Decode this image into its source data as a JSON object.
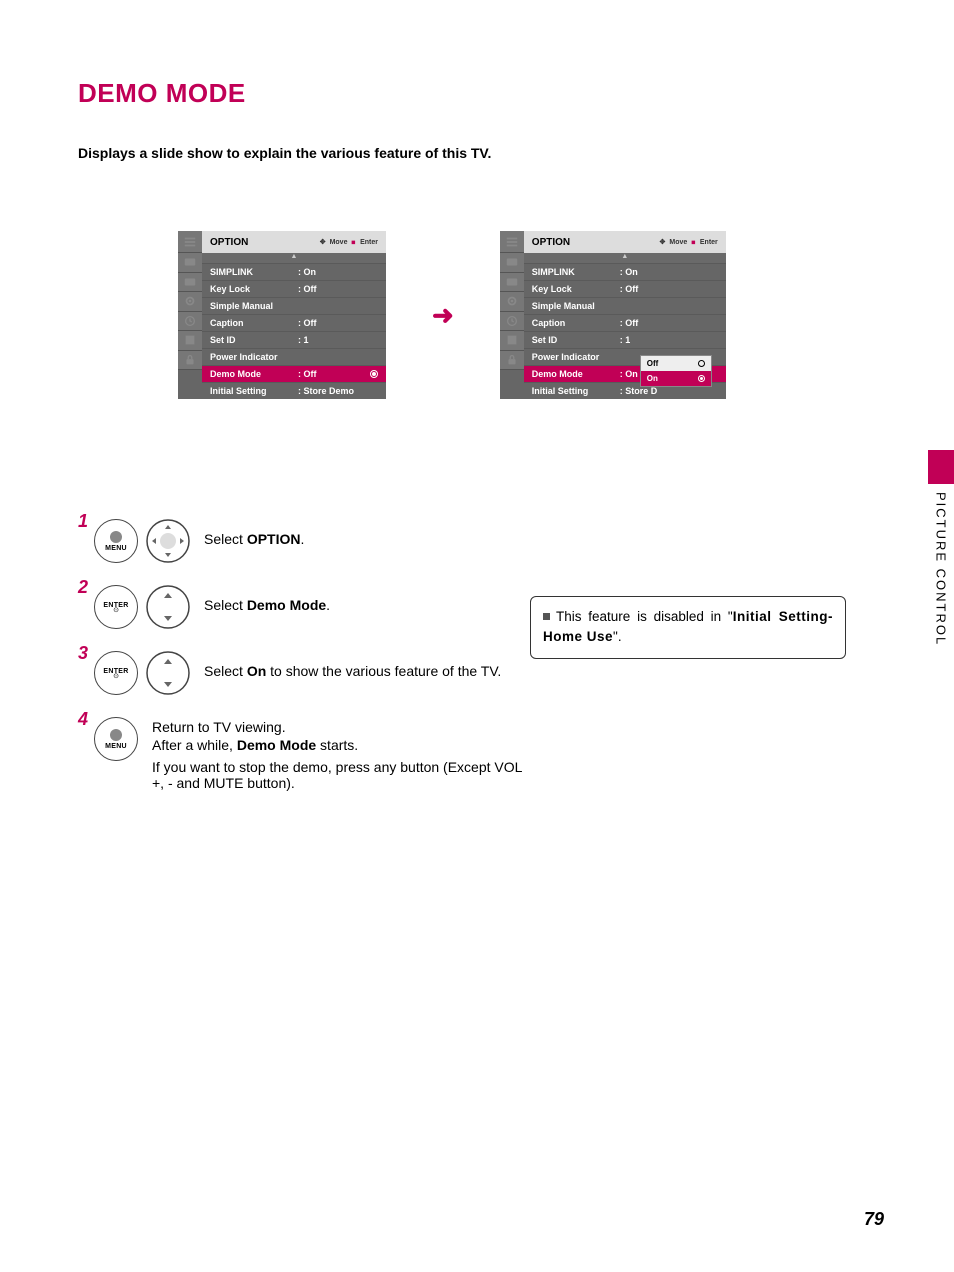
{
  "title": "DEMO MODE",
  "subtitle": "Displays a slide show to explain the various feature of this TV.",
  "side_tab": "PICTURE CONTROL",
  "page_number": "79",
  "osd": {
    "header_title": "OPTION",
    "hint_move": "Move",
    "hint_enter": "Enter",
    "items": [
      {
        "label": "SIMPLINK",
        "value": ": On"
      },
      {
        "label": "Key Lock",
        "value": ": Off"
      },
      {
        "label": "Simple Manual",
        "value": ""
      },
      {
        "label": "Caption",
        "value": ": Off"
      },
      {
        "label": "Set ID",
        "value": ": 1"
      },
      {
        "label": "Power Indicator",
        "value": ""
      },
      {
        "label": "Demo Mode",
        "value": ": Off"
      },
      {
        "label": "Initial Setting",
        "value": ": Store Demo"
      }
    ]
  },
  "osd2": {
    "items": [
      {
        "label": "SIMPLINK",
        "value": ": On"
      },
      {
        "label": "Key Lock",
        "value": ": Off"
      },
      {
        "label": "Simple Manual",
        "value": ""
      },
      {
        "label": "Caption",
        "value": ": Off"
      },
      {
        "label": "Set ID",
        "value": ": 1"
      },
      {
        "label": "Power Indicator",
        "value": ""
      },
      {
        "label": "Demo Mode",
        "value": ": On"
      },
      {
        "label": "Initial Setting",
        "value": ": Store D"
      }
    ],
    "popup": {
      "off": "Off",
      "on": "On"
    }
  },
  "buttons": {
    "menu": "MENU",
    "enter": "ENTER"
  },
  "steps": {
    "s1": {
      "pre": "Select ",
      "b": "OPTION",
      "post": "."
    },
    "s2": {
      "pre": "Select ",
      "b": "Demo Mode",
      "post": "."
    },
    "s3": {
      "pre": "Select ",
      "b": "On",
      "post": " to show the various feature of the TV."
    },
    "s4a": "Return to TV viewing.",
    "s4b_pre": "After a while, ",
    "s4b_b": "Demo Mode",
    "s4b_post": " starts.",
    "s4c": "If you want to stop the demo, press any button (Except VOL +, - and MUTE button)."
  },
  "note": {
    "pre": "This feature is disabled in \"",
    "b": "Initial Setting-Home Use",
    "post": "\"."
  },
  "nums": {
    "n1": "1",
    "n2": "2",
    "n3": "3",
    "n4": "4"
  }
}
